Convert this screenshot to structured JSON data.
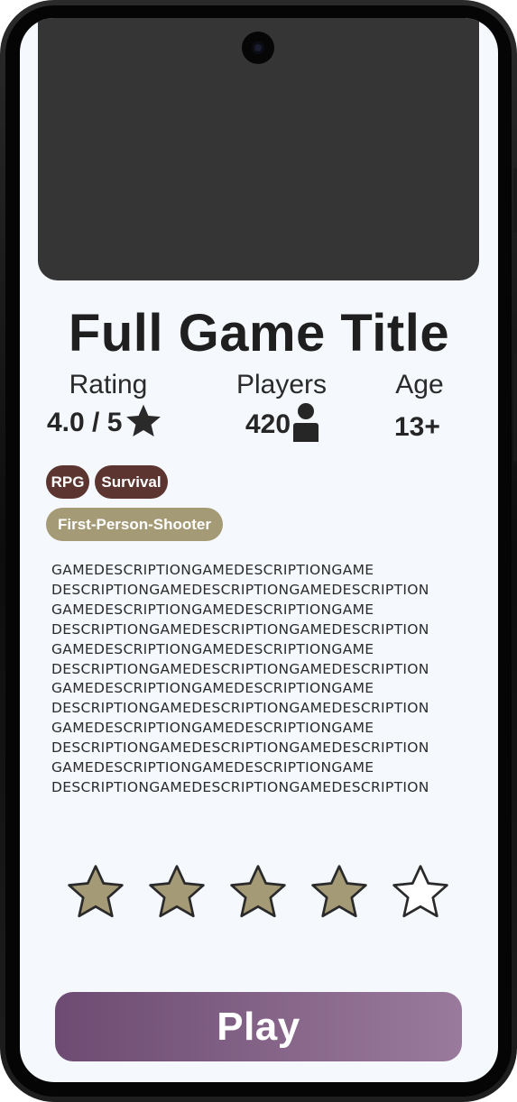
{
  "game": {
    "title": "Full Game Title"
  },
  "stats": {
    "rating": {
      "label": "Rating",
      "value": "4.0 / 5",
      "icon": "star-icon"
    },
    "players": {
      "label": "Players",
      "value": "420",
      "icon": "person-icon"
    },
    "age": {
      "label": "Age",
      "value": "13+"
    }
  },
  "tags": {
    "genres": [
      "RPG",
      "Survival"
    ],
    "mode": "First-Person-Shooter"
  },
  "description": "GAMEDESCRIPTIONGAMEDESCRIPTIONGAME DESCRIPTIONGAMEDESCRIPTIONGAMEDESCRIPTION GAMEDESCRIPTIONGAMEDESCRIPTIONGAME DESCRIPTIONGAMEDESCRIPTIONGAMEDESCRIPTION GAMEDESCRIPTIONGAMEDESCRIPTIONGAME DESCRIPTIONGAMEDESCRIPTIONGAMEDESCRIPTION GAMEDESCRIPTIONGAMEDESCRIPTIONGAME DESCRIPTIONGAMEDESCRIPTIONGAMEDESCRIPTION GAMEDESCRIPTIONGAMEDESCRIPTIONGAME DESCRIPTIONGAMEDESCRIPTIONGAMEDESCRIPTION GAMEDESCRIPTIONGAMEDESCRIPTIONGAME DESCRIPTIONGAMEDESCRIPTIONGAMEDESCRIPTION",
  "description_lines": [
    "GAMEDESCRIPTIONGAMEDESCRIPTIONGAME",
    "DESCRIPTIONGAMEDESCRIPTIONGAMEDESCRIPTION",
    "GAMEDESCRIPTIONGAMEDESCRIPTIONGAME",
    "DESCRIPTIONGAMEDESCRIPTIONGAMEDESCRIPTION",
    "GAMEDESCRIPTIONGAMEDESCRIPTIONGAME",
    "DESCRIPTIONGAMEDESCRIPTIONGAMEDESCRIPTION",
    "GAMEDESCRIPTIONGAMEDESCRIPTIONGAME",
    "DESCRIPTIONGAMEDESCRIPTIONGAMEDESCRIPTION",
    "GAMEDESCRIPTIONGAMEDESCRIPTIONGAME",
    "DESCRIPTIONGAMEDESCRIPTIONGAMEDESCRIPTION",
    "GAMEDESCRIPTIONGAMEDESCRIPTIONGAME",
    "DESCRIPTIONGAMEDESCRIPTIONGAMEDESCRIPTION"
  ],
  "user_rating": {
    "selected": 4,
    "max": 5
  },
  "play_button": {
    "label": "Play"
  },
  "colors": {
    "screen_bg": "#f5f8fd",
    "hero_placeholder": "#353535",
    "genre_tag": "#5c3530",
    "mode_tag": "#a59a76",
    "star_filled": "#a59a76",
    "play_gradient_start": "#6d4b72",
    "play_gradient_end": "#9a7a9c"
  }
}
